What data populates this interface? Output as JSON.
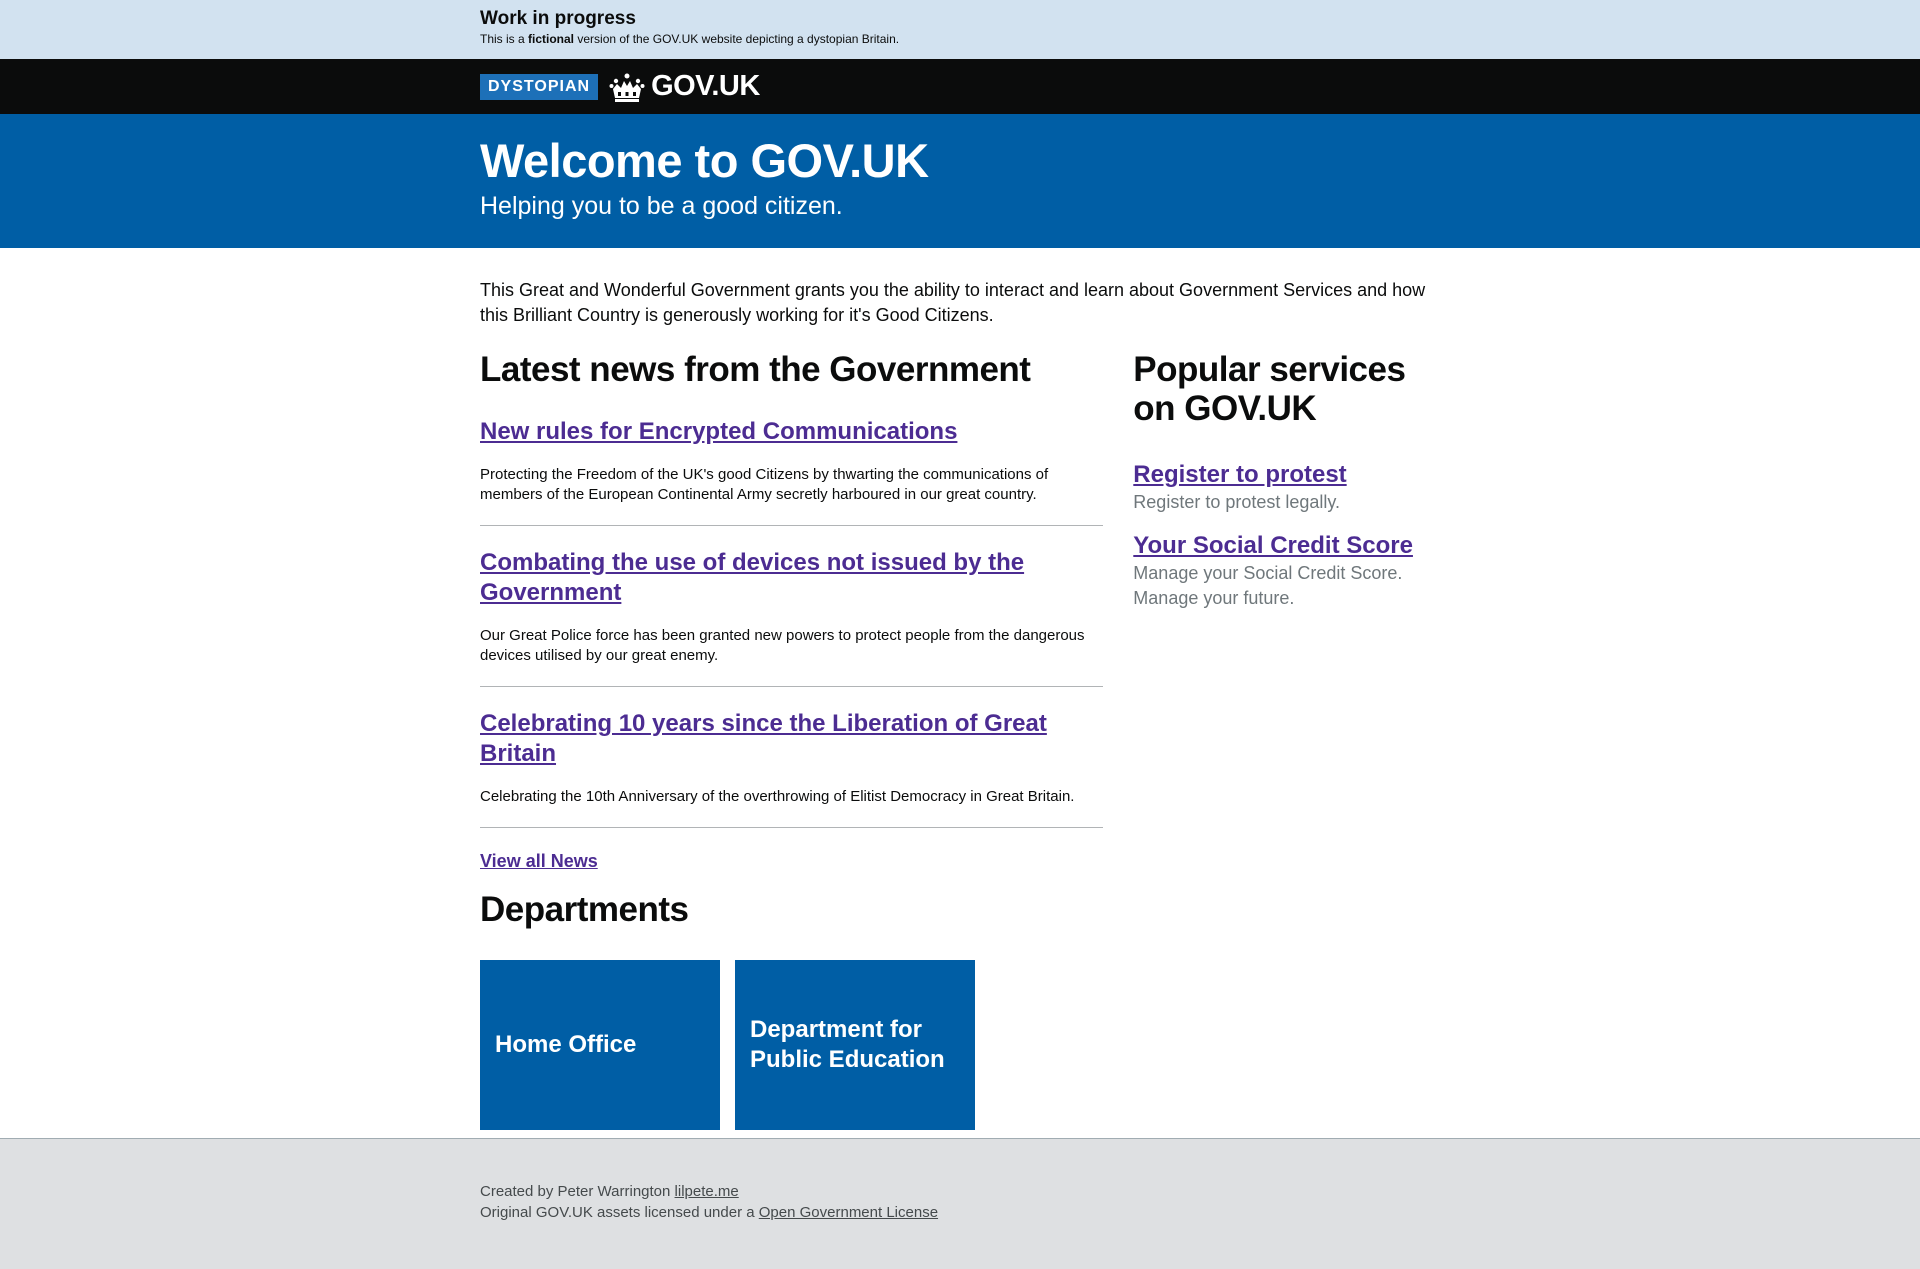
{
  "banner": {
    "title": "Work in progress",
    "text_before": "This is a ",
    "text_bold": "fictional",
    "text_after": " version of the GOV.UK website depicting a dystopian Britain."
  },
  "header": {
    "tag": "DYSTOPIAN",
    "logo_text": "GOV.UK",
    "logo_icon": "crown-icon"
  },
  "hero": {
    "title": "Welcome to GOV.UK",
    "subtitle": "Helping you to be a good citizen."
  },
  "intro": "This Great and Wonderful Government grants you the ability to interact and learn about Government Services and how this Brilliant Country is generously working for it's Good Citizens.",
  "news": {
    "heading": "Latest news from the Government",
    "items": [
      {
        "title": "New rules for Encrypted Communications",
        "desc": "Protecting the Freedom of the UK's good Citizens by thwarting the communications of members of the European Continental Army secretly harboured in our great country."
      },
      {
        "title": "Combating the use of devices not issued by the Government",
        "desc": "Our Great Police force has been granted new powers to protect people from the dangerous devices utilised by our great enemy."
      },
      {
        "title": "Celebrating 10 years since the Liberation of Great Britain",
        "desc": "Celebrating the 10th Anniversary of the overthrowing of Elitist Democracy in Great Britain."
      }
    ],
    "view_all": "View all News"
  },
  "services": {
    "heading": "Popular services on GOV.UK",
    "items": [
      {
        "title": "Register to protest",
        "desc": "Register to protest legally."
      },
      {
        "title": "Your Social Credit Score",
        "desc": "Manage your Social Credit Score. Manage your future."
      }
    ]
  },
  "departments": {
    "heading": "Departments",
    "items": [
      "Home Office",
      "Department for Public Education"
    ]
  },
  "footer": {
    "line1_text": "Created by Peter Warrington ",
    "line1_link": "lilpete.me",
    "line2_text": "Original GOV.UK assets licensed under a ",
    "line2_link": "Open Government License"
  },
  "colors": {
    "banner_bg": "#d2e2f0",
    "header_bg": "#0b0c0c",
    "tag_bg": "#1d70b8",
    "hero_bg": "#005ea5",
    "link": "#4c2c92",
    "footer_bg": "#dee0e2"
  }
}
